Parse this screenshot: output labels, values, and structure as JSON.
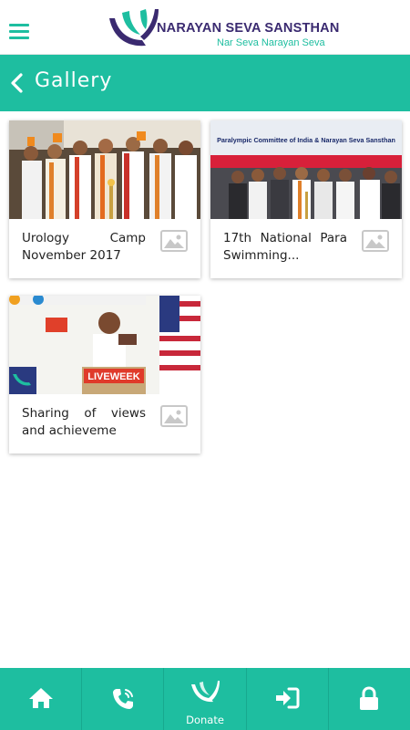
{
  "header": {
    "brand": "NARAYAN SEVA SANSTHAN",
    "tagline": "Nar Seva Narayan Seva",
    "colors": {
      "accent": "#1ebea0",
      "brand": "#3a2a70"
    }
  },
  "titlebar": {
    "title": "Gallery"
  },
  "gallery": {
    "items": [
      {
        "caption": "Urology Camp November 2017",
        "thumbnail": "photo-lamp-lighting-ceremony",
        "banner_text": ""
      },
      {
        "caption": "17th National Para Swimming...",
        "thumbnail": "photo-para-swimming-ceremony",
        "banner_text": "Paralympic Committee of India & Narayan Seva Sansthan"
      },
      {
        "caption": "Sharing of views and achieveme",
        "thumbnail": "photo-speaker-at-podium",
        "banner_text": "LIVEWEEK"
      }
    ]
  },
  "bottom_nav": {
    "items": [
      {
        "icon": "home-icon",
        "label": ""
      },
      {
        "icon": "phone-icon",
        "label": ""
      },
      {
        "icon": "donate-icon",
        "label": "Donate"
      },
      {
        "icon": "login-icon",
        "label": ""
      },
      {
        "icon": "lock-icon",
        "label": ""
      }
    ]
  }
}
